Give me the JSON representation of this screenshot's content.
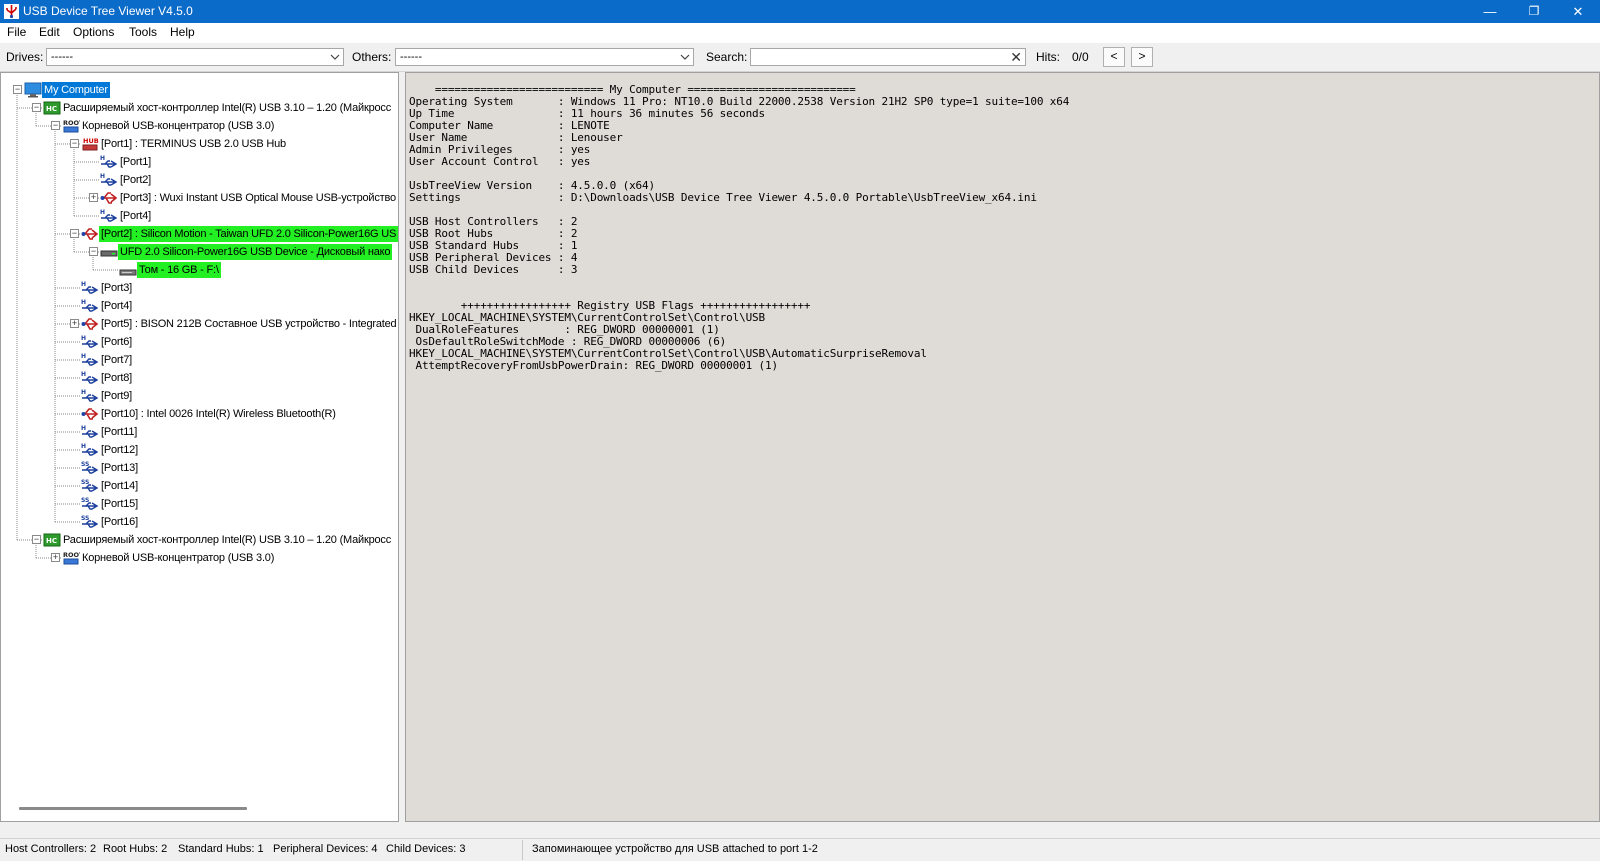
{
  "window": {
    "title": "USB Device Tree Viewer V4.5.0",
    "minimize_glyph": "—",
    "maximize_glyph": "❐",
    "close_glyph": "✕"
  },
  "menu": [
    "File",
    "Edit",
    "Options",
    "Tools",
    "Help"
  ],
  "toolbar": {
    "drives_label": "Drives:",
    "drives_value": "------",
    "others_label": "Others:",
    "others_value": "------",
    "search_label": "Search:",
    "search_value": "",
    "hits_label": "Hits:",
    "hits_value": "0/0",
    "prev_label": "<",
    "next_label": ">"
  },
  "tree": [
    {
      "label": "My Computer",
      "icon": "computer-icon",
      "expander": "minus",
      "highlight": "blue"
    },
    {
      "label": "Расширяемый хост-контроллер Intel(R) USB 3.10 – 1.20 (Майкросс",
      "icon": "host-controller-icon",
      "expander": "minus"
    },
    {
      "label": "Корневой USB-концентратор (USB 3.0)",
      "icon": "root-hub-icon",
      "expander": "minus"
    },
    {
      "label": "[Port1] : TERMINUS USB 2.0 USB Hub",
      "icon": "hub-icon",
      "expander": "minus"
    },
    {
      "label": "[Port1]",
      "icon": "usb-port-icon"
    },
    {
      "label": "[Port2]",
      "icon": "usb-port-icon"
    },
    {
      "label": "[Port3] : Wuxi Instant USB Optical Mouse USB-устройство",
      "icon": "usb-device-icon",
      "expander": "plus"
    },
    {
      "label": "[Port4]",
      "icon": "usb-port-icon"
    },
    {
      "label": "[Port2] : Silicon Motion - Taiwan UFD 2.0 Silicon-Power16G US",
      "icon": "usb-device-icon",
      "expander": "minus",
      "highlight": "green"
    },
    {
      "label": "UFD 2.0 Silicon-Power16G USB Device - Дисковый нако",
      "icon": "disk-drive-icon",
      "expander": "minus",
      "highlight": "green"
    },
    {
      "label": "Том - 16 GB - F:\\",
      "icon": "volume-icon",
      "highlight": "green"
    },
    {
      "label": "[Port3]",
      "icon": "usb-port-icon"
    },
    {
      "label": "[Port4]",
      "icon": "usb-port-icon"
    },
    {
      "label": "[Port5] : BISON 212B Составное USB устройство - Integrated",
      "icon": "usb-device-icon",
      "expander": "plus"
    },
    {
      "label": "[Port6]",
      "icon": "usb-port-icon"
    },
    {
      "label": "[Port7]",
      "icon": "usb-port-icon"
    },
    {
      "label": "[Port8]",
      "icon": "usb-port-icon"
    },
    {
      "label": "[Port9]",
      "icon": "usb-port-icon"
    },
    {
      "label": "[Port10] : Intel 0026 Intel(R) Wireless Bluetooth(R)",
      "icon": "usb-device-icon"
    },
    {
      "label": "[Port11]",
      "icon": "usb-port-icon"
    },
    {
      "label": "[Port12]",
      "icon": "usb-port-icon"
    },
    {
      "label": "[Port13]",
      "icon": "usb-ss-port-icon"
    },
    {
      "label": "[Port14]",
      "icon": "usb-ss-port-icon"
    },
    {
      "label": "[Port15]",
      "icon": "usb-ss-port-icon"
    },
    {
      "label": "[Port16]",
      "icon": "usb-ss-port-icon"
    },
    {
      "label": "Расширяемый хост-контроллер Intel(R) USB 3.10 – 1.20 (Майкросс",
      "icon": "host-controller-icon",
      "expander": "minus"
    },
    {
      "label": "Корневой USB-концентратор (USB 3.0)",
      "icon": "root-hub-icon",
      "expander": "plus"
    }
  ],
  "info_text": "    ========================== My Computer ==========================\nOperating System       : Windows 11 Pro: NT10.0 Build 22000.2538 Version 21H2 SP0 type=1 suite=100 x64\nUp Time                : 11 hours 36 minutes 56 seconds\nComputer Name          : LENOTE\nUser Name              : Lenouser\nAdmin Privileges       : yes\nUser Account Control   : yes\n\nUsbTreeView Version    : 4.5.0.0 (x64)\nSettings               : D:\\Downloads\\USB Device Tree Viewer 4.5.0.0 Portable\\UsbTreeView_x64.ini\n\nUSB Host Controllers   : 2\nUSB Root Hubs          : 2\nUSB Standard Hubs      : 1\nUSB Peripheral Devices : 4\nUSB Child Devices      : 3\n\n\n        +++++++++++++++++ Registry USB Flags +++++++++++++++++\nHKEY_LOCAL_MACHINE\\SYSTEM\\CurrentControlSet\\Control\\USB\n DualRoleFeatures       : REG_DWORD 00000001 (1)\n OsDefaultRoleSwitchMode : REG_DWORD 00000006 (6)\nHKEY_LOCAL_MACHINE\\SYSTEM\\CurrentControlSet\\Control\\USB\\AutomaticSurpriseRemoval\n AttemptRecoveryFromUsbPowerDrain: REG_DWORD 00000001 (1)",
  "status": {
    "host_controllers": "Host Controllers: 2",
    "root_hubs": "Root Hubs: 2",
    "standard_hubs": "Standard Hubs: 1",
    "peripheral_devices": "Peripheral Devices: 4",
    "child_devices": "Child Devices: 3",
    "message": "Запоминающее устройство для USB attached to port 1-2"
  },
  "colors": {
    "titlebar": "#0a6bc9",
    "selection_blue": "#0078d7",
    "highlight_green": "#22f022",
    "info_background": "#dfdcd7"
  }
}
